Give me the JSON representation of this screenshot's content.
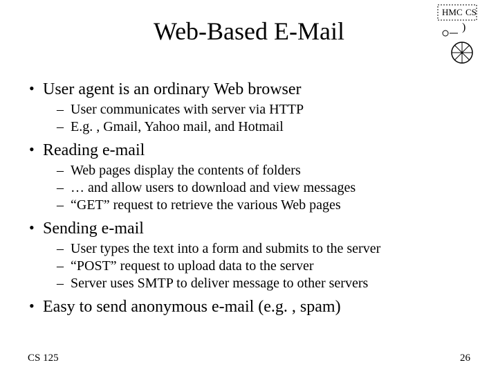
{
  "title": "Web-Based E-Mail",
  "logo": {
    "line1": "HMC",
    "line2": "CS"
  },
  "bullets": [
    {
      "text": "User agent is an ordinary Web browser",
      "sub": [
        "User communicates with server via HTTP",
        "E.g. , Gmail, Yahoo mail, and Hotmail"
      ]
    },
    {
      "text": "Reading e-mail",
      "sub": [
        "Web pages display the contents of folders",
        "… and allow users to download and view messages",
        "“GET” request to retrieve the various Web pages"
      ]
    },
    {
      "text": "Sending e-mail",
      "sub": [
        "User types the text into a form and submits to the server",
        "“POST” request to upload data to the server",
        "Server uses SMTP to deliver message to other servers"
      ]
    },
    {
      "text": "Easy to send anonymous e-mail (e.g. , spam)",
      "sub": []
    }
  ],
  "footer": {
    "left": "CS 125",
    "right": "26"
  }
}
